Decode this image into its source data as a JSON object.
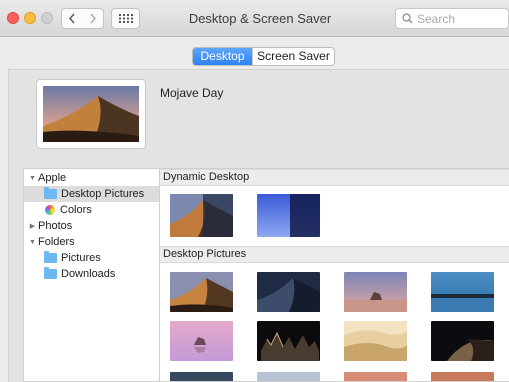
{
  "window": {
    "title": "Desktop & Screen Saver"
  },
  "search": {
    "placeholder": "Search"
  },
  "tabs": {
    "desktop": "Desktop",
    "screen_saver": "Screen Saver"
  },
  "current_wallpaper": {
    "name": "Mojave Day"
  },
  "sidebar": {
    "apple": "Apple",
    "desktop_pictures": "Desktop Pictures",
    "colors": "Colors",
    "photos": "Photos",
    "folders": "Folders",
    "pictures": "Pictures",
    "downloads": "Downloads"
  },
  "sections": {
    "dynamic_desktop": "Dynamic Desktop",
    "desktop_pictures": "Desktop Pictures"
  },
  "colors": {
    "accent": "#2e83f4",
    "close": "#fc605c",
    "minimize": "#fdbc40",
    "folder": "#6cb8f0"
  }
}
